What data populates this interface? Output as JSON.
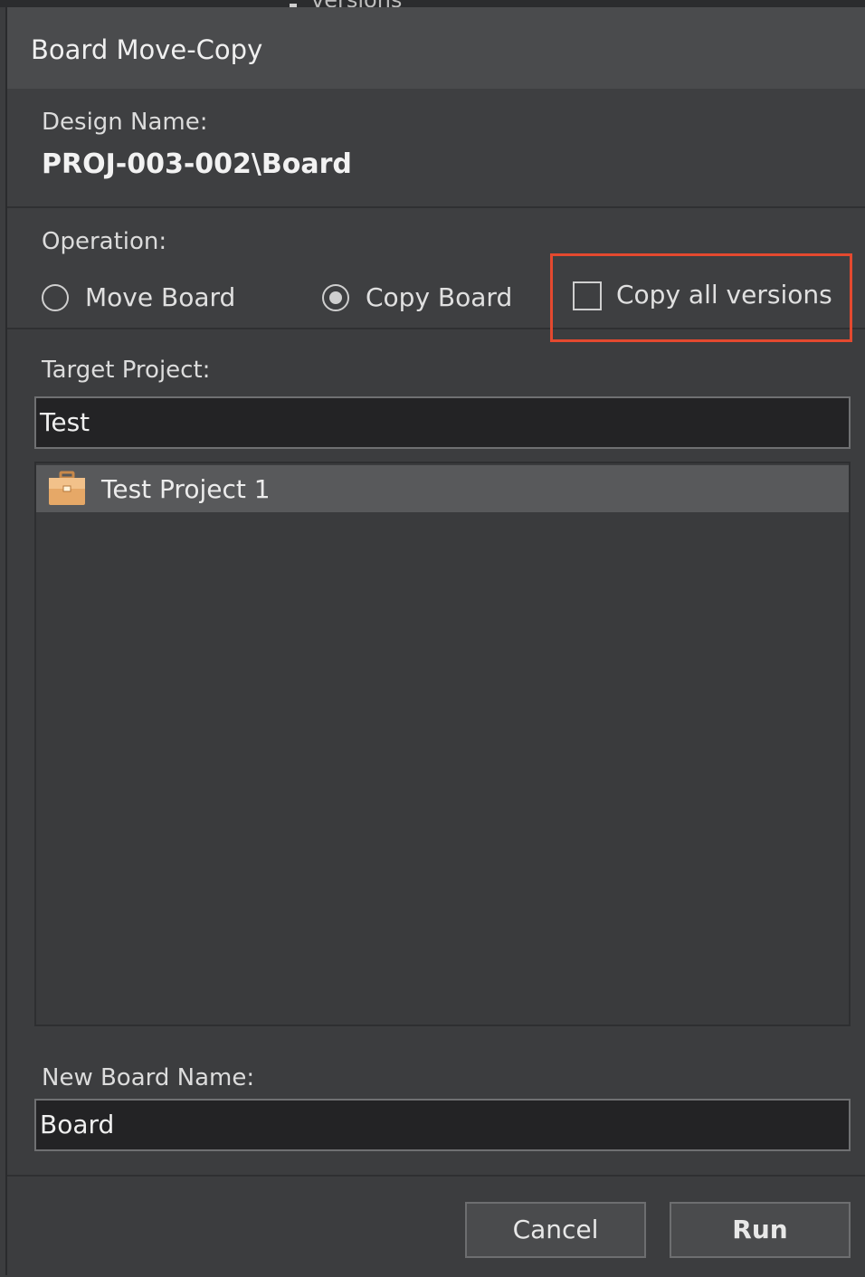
{
  "background_peek": {
    "text": "versions"
  },
  "dialog": {
    "title": "Board Move-Copy",
    "design_name_label": "Design Name:",
    "design_name_value": "PROJ-003-002\\Board",
    "operation_label": "Operation:",
    "options": [
      {
        "label": "Move Board",
        "selected": false
      },
      {
        "label": "Copy Board",
        "selected": true
      }
    ],
    "copy_all_versions": {
      "label": "Copy all versions",
      "checked": false
    },
    "highlight_color": "#e4492f",
    "target_project_label": "Target Project:",
    "target_project_value": "Test",
    "project_list": [
      {
        "label": "Test Project 1",
        "icon": "briefcase-icon",
        "selected": true
      }
    ],
    "new_board_name_label": "New Board Name:",
    "new_board_name_value": "Board",
    "buttons": {
      "cancel": "Cancel",
      "run": "Run"
    }
  }
}
